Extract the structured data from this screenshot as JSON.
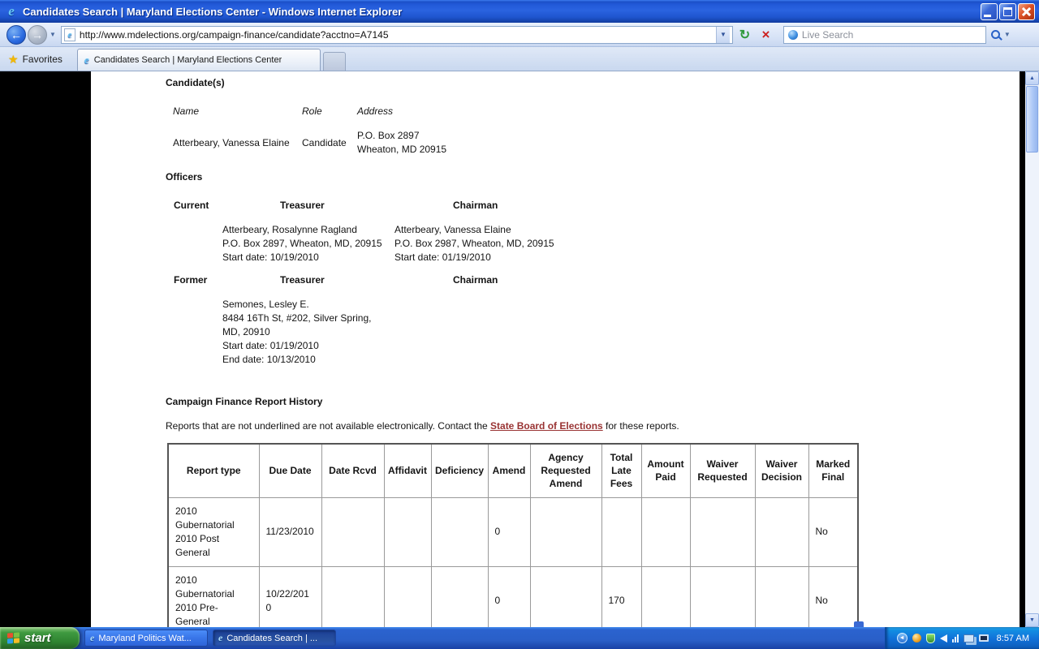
{
  "icons": {
    "back_arrow": "←",
    "forward_arrow": "→",
    "dropdown_small": "▼",
    "refresh": "↻",
    "stop": "×",
    "favorites_star": "★",
    "ie_logo": "e",
    "scroll_up": "▲",
    "scroll_down": "▼",
    "tray_collapse": "◄"
  },
  "window": {
    "title": "Candidates Search | Maryland Elections Center - Windows Internet Explorer"
  },
  "toolbar": {
    "url": "http://www.mdelections.org/campaign-finance/candidate?acctno=A7145",
    "search_placeholder": "Live Search"
  },
  "tabs": {
    "favorites_label": "Favorites",
    "active_tab": "Candidates Search | Maryland Elections Center"
  },
  "content": {
    "candidates": {
      "heading": "Candidate(s)",
      "columns": [
        "Name",
        "Role",
        "Address"
      ],
      "row": {
        "name": "Atterbeary, Vanessa Elaine",
        "role": "Candidate",
        "address_line1": "P.O. Box 2897",
        "address_line2": "Wheaton, MD 20915"
      }
    },
    "officers": {
      "heading": "Officers",
      "current_label": "Current",
      "former_label": "Former",
      "treasurer_label": "Treasurer",
      "chairman_label": "Chairman",
      "current_treasurer": [
        "Atterbeary, Rosalynne Ragland",
        "P.O. Box 2897, Wheaton, MD, 20915",
        "Start date: 10/19/2010"
      ],
      "current_chairman": [
        "Atterbeary, Vanessa Elaine",
        "P.O. Box 2987, Wheaton, MD, 20915",
        "Start date: 01/19/2010"
      ],
      "former_treasurer": [
        "Semones, Lesley E.",
        "8484 16Th St, #202, Silver Spring,",
        "MD, 20910",
        "Start date: 01/19/2010",
        "End date: 10/13/2010"
      ]
    },
    "report_history": {
      "heading": "Campaign Finance Report History",
      "note_prefix": "Reports that are not underlined are not available electronically. Contact the ",
      "note_link": "State Board of Elections",
      "note_suffix": " for these reports.",
      "columns": [
        "Report type",
        "Due Date",
        "Date Rcvd",
        "Affidavit",
        "Deficiency",
        "Amend",
        "Agency Requested Amend",
        "Total Late Fees",
        "Amount Paid",
        "Waiver Requested",
        "Waiver Decision",
        "Marked Final"
      ],
      "rows": [
        [
          "2010 Gubernatorial 2010 Post General",
          "11/23/2010",
          "",
          "",
          "",
          "0",
          "",
          "",
          "",
          "",
          "",
          "No"
        ],
        [
          "2010 Gubernatorial 2010 Pre-General",
          "10/22/2010",
          "",
          "",
          "",
          "0",
          "",
          "170",
          "",
          "",
          "",
          "No"
        ]
      ]
    }
  },
  "taskbar": {
    "start_label": "start",
    "tasks": [
      "Maryland Politics Wat...",
      "Candidates Search | ..."
    ],
    "time": "8:57 AM"
  }
}
